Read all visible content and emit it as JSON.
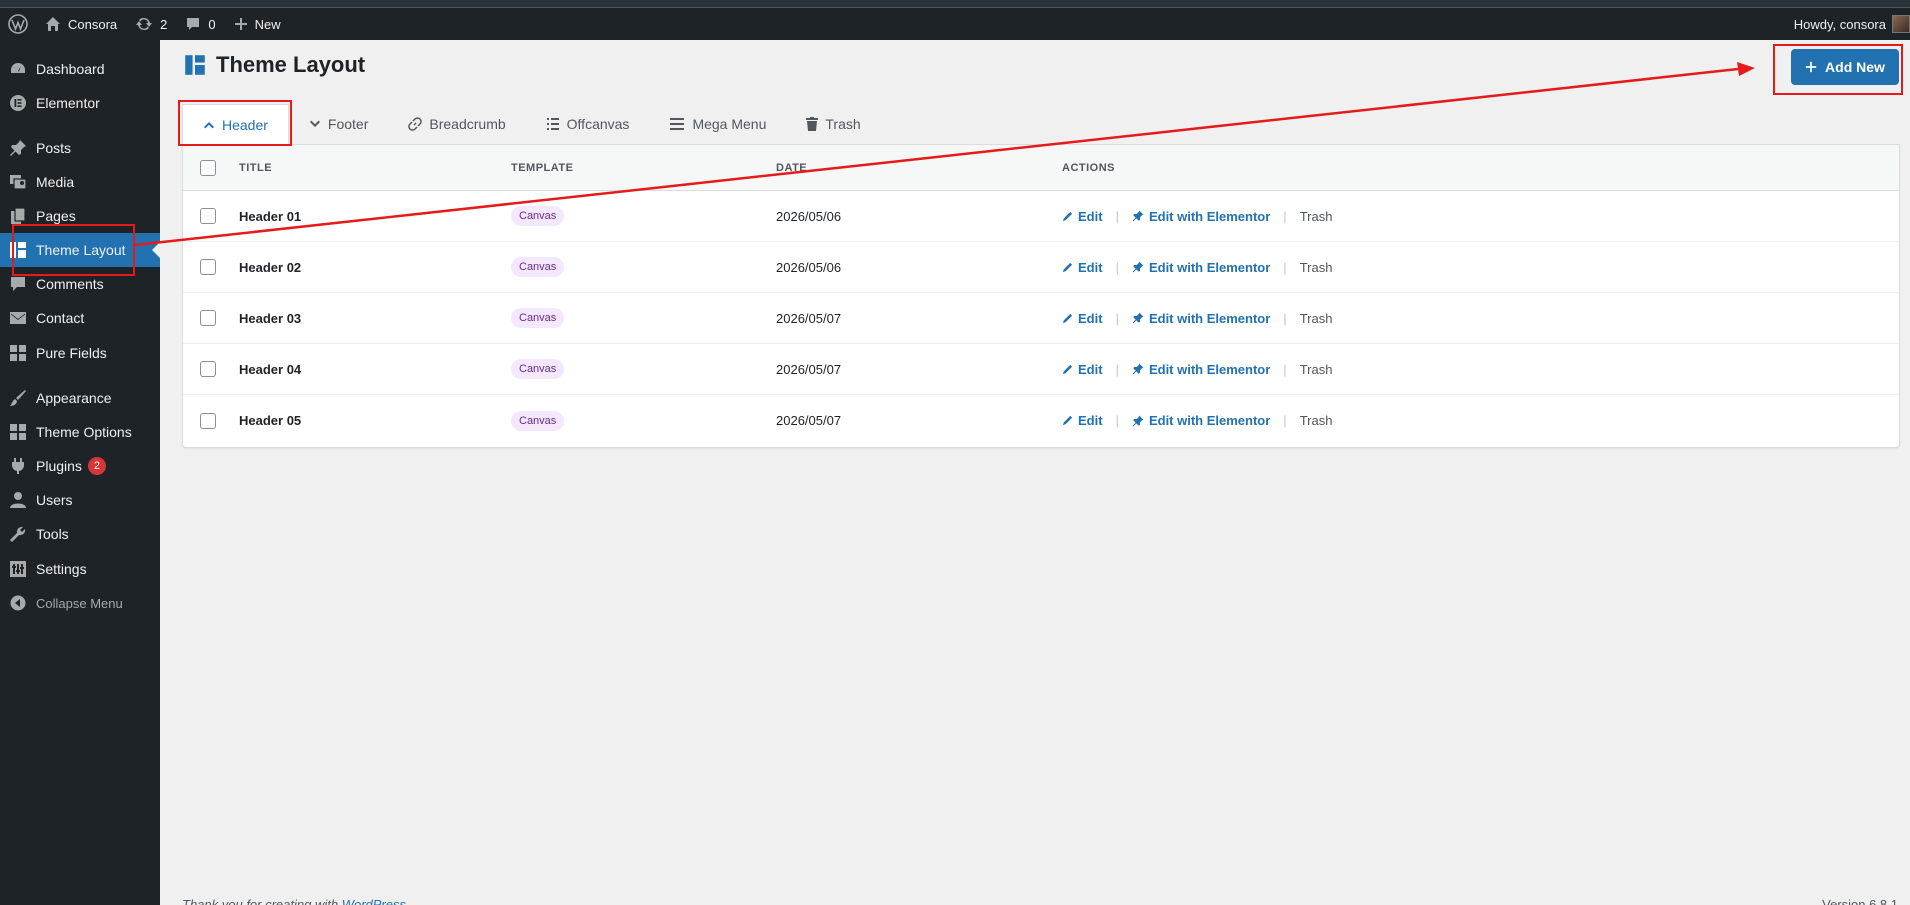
{
  "adminbar": {
    "site_name": "Consora",
    "updates_count": "2",
    "comments_count": "0",
    "new_label": "New",
    "howdy": "Howdy, consora"
  },
  "sidebar": {
    "items": [
      {
        "label": "Dashboard",
        "icon": "dashboard-icon"
      },
      {
        "label": "Elementor",
        "icon": "elementor-icon"
      },
      {
        "label": "Posts",
        "icon": "pin-icon"
      },
      {
        "label": "Media",
        "icon": "media-icon"
      },
      {
        "label": "Pages",
        "icon": "pages-icon"
      },
      {
        "label": "Theme Layout",
        "icon": "layout-icon"
      },
      {
        "label": "Comments",
        "icon": "comment-icon"
      },
      {
        "label": "Contact",
        "icon": "mail-icon"
      },
      {
        "label": "Pure Fields",
        "icon": "grid-icon"
      },
      {
        "label": "Appearance",
        "icon": "brush-icon"
      },
      {
        "label": "Theme Options",
        "icon": "grid-icon"
      },
      {
        "label": "Plugins",
        "icon": "plugin-icon",
        "badge": "2"
      },
      {
        "label": "Users",
        "icon": "user-icon"
      },
      {
        "label": "Tools",
        "icon": "wrench-icon"
      },
      {
        "label": "Settings",
        "icon": "settings-icon"
      },
      {
        "label": "Collapse Menu",
        "icon": "collapse-icon"
      }
    ]
  },
  "page": {
    "title": "Theme Layout",
    "add_new_label": "Add New"
  },
  "tabs": [
    {
      "label": "Header",
      "active": true
    },
    {
      "label": "Footer"
    },
    {
      "label": "Breadcrumb"
    },
    {
      "label": "Offcanvas"
    },
    {
      "label": "Mega Menu"
    },
    {
      "label": "Trash"
    }
  ],
  "table": {
    "headers": {
      "title": "TITLE",
      "template": "TEMPLATE",
      "date": "DATE",
      "actions": "ACTIONS"
    },
    "rows": [
      {
        "title": "Header 01",
        "template": "Canvas",
        "date": "2026/05/06"
      },
      {
        "title": "Header 02",
        "template": "Canvas",
        "date": "2026/05/06"
      },
      {
        "title": "Header 03",
        "template": "Canvas",
        "date": "2026/05/07"
      },
      {
        "title": "Header 04",
        "template": "Canvas",
        "date": "2026/05/07"
      },
      {
        "title": "Header 05",
        "template": "Canvas",
        "date": "2026/05/07"
      }
    ],
    "action_labels": {
      "edit": "Edit",
      "edit_elementor": "Edit with Elementor",
      "trash": "Trash"
    }
  },
  "footer": {
    "left_prefix": "Thank you for creating with ",
    "left_link": "WordPress",
    "right": "Version 6.8.1"
  },
  "colors": {
    "accent": "#2271b1",
    "annotation": "#e31b1b",
    "sidebar_bg": "#1d2327"
  }
}
